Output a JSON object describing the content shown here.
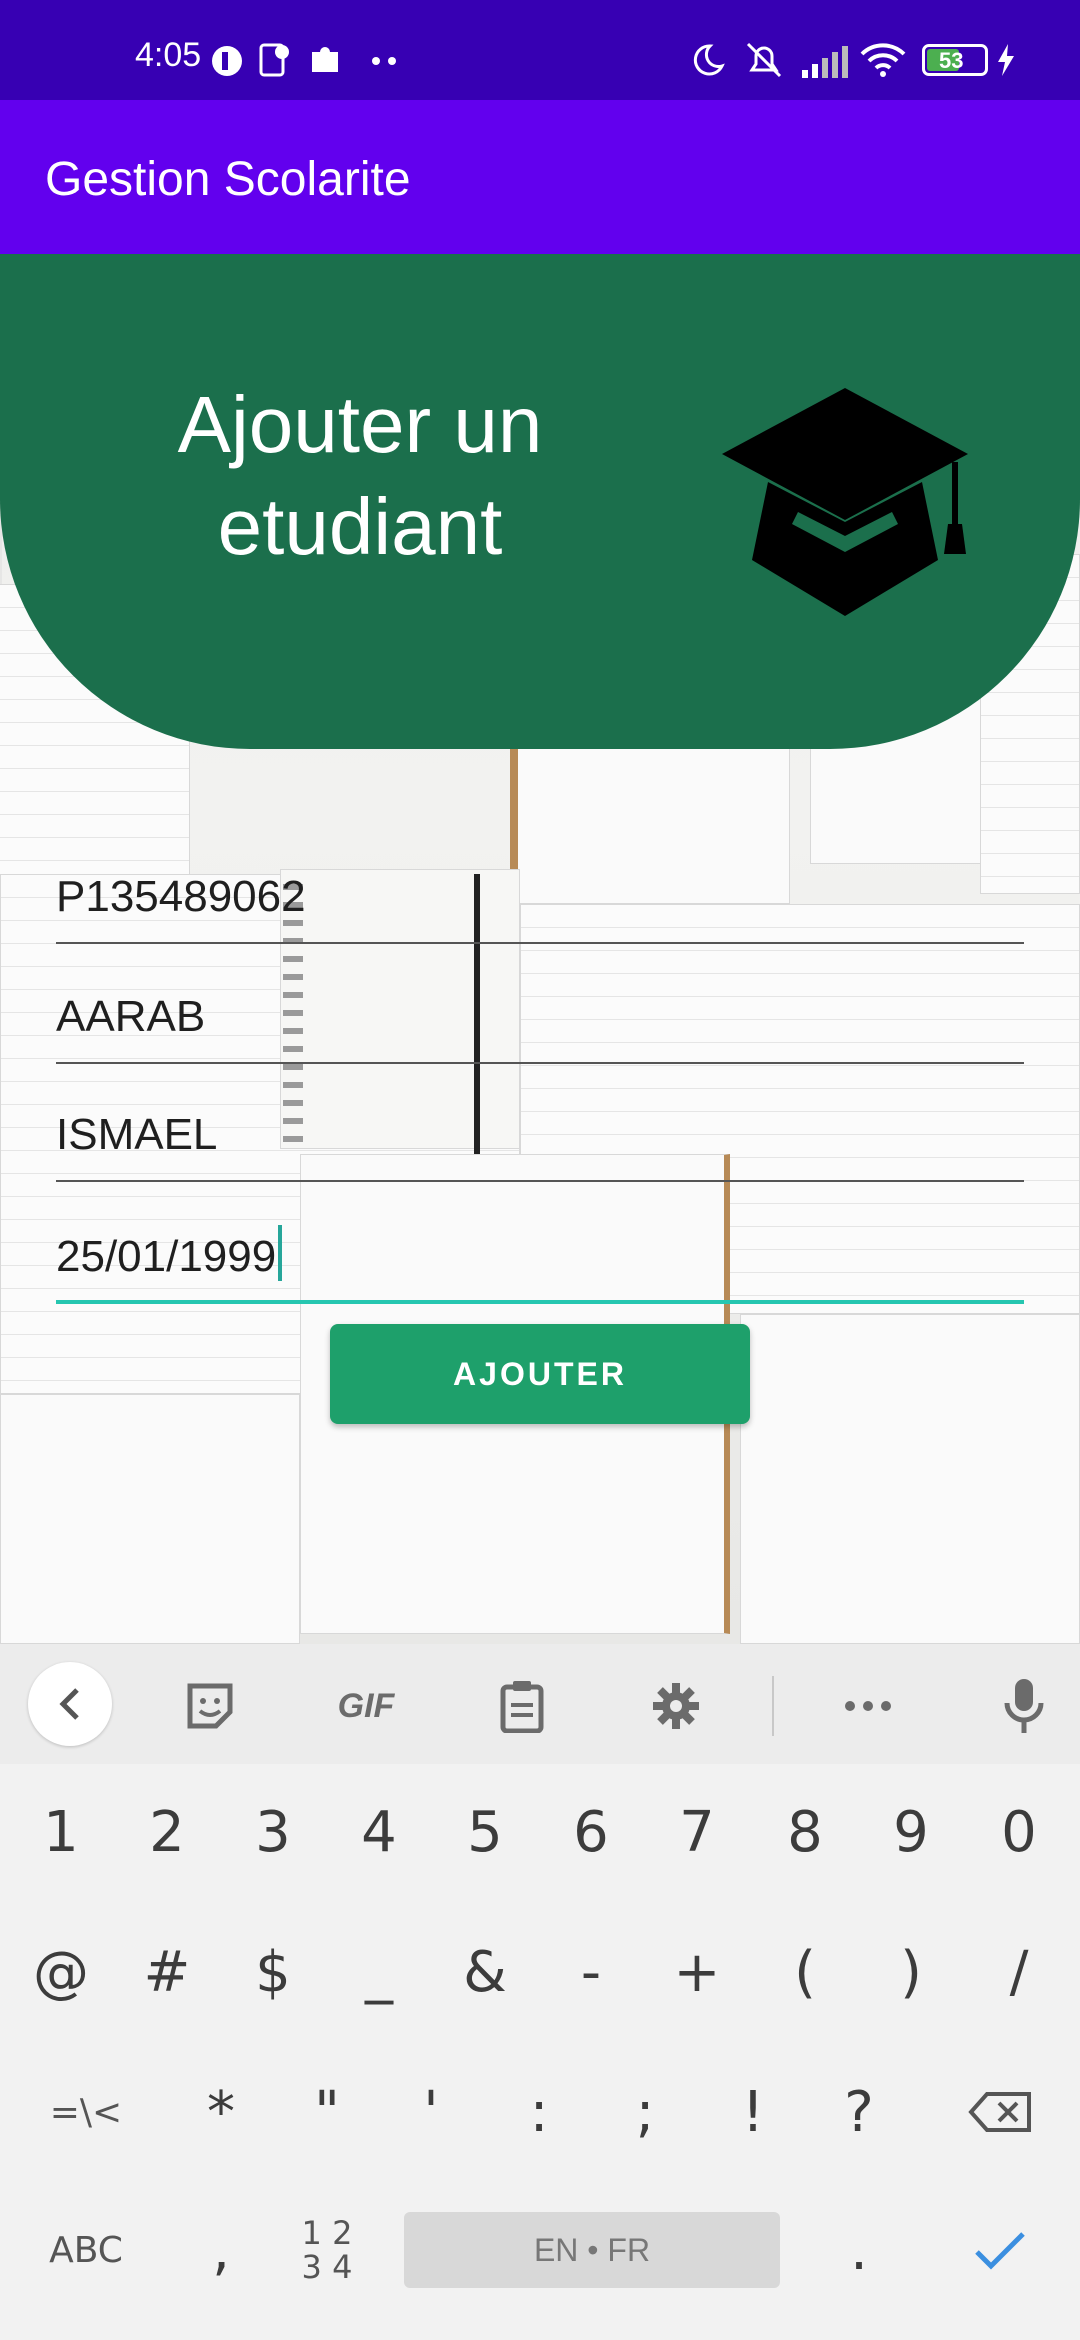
{
  "status_bar": {
    "time": "4:05",
    "battery": "53"
  },
  "app_bar": {
    "title": "Gestion Scolarite"
  },
  "hero": {
    "title_line1": "Ajouter un",
    "title_line2": "etudiant",
    "icon": "graduation-cap-icon"
  },
  "form": {
    "fields": [
      {
        "value": "P135489062"
      },
      {
        "value": "AARAB"
      },
      {
        "value": "ISMAEL"
      },
      {
        "value": "25/01/1999"
      }
    ],
    "submit_label": "AJOUTER"
  },
  "keyboard": {
    "toolbar": {
      "gif_label": "GIF"
    },
    "row1": [
      "1",
      "2",
      "3",
      "4",
      "5",
      "6",
      "7",
      "8",
      "9",
      "0"
    ],
    "row2": [
      "@",
      "#",
      "$",
      "_",
      "&",
      "-",
      "+",
      "(",
      ")",
      "/"
    ],
    "row3": [
      "=\\<",
      "*",
      "\"",
      "'",
      ":",
      ";",
      "!",
      "?"
    ],
    "abc_label": "ABC",
    "comma": ",",
    "numpad_label_top": "1 2",
    "numpad_label_bottom": "3 4",
    "space_label": "EN • FR",
    "period": "."
  },
  "colors": {
    "status_bar": "#3700b3",
    "app_bar": "#6200ee",
    "hero": "#1b6f4c",
    "button": "#1ea06b",
    "accent": "#26c6b0"
  }
}
